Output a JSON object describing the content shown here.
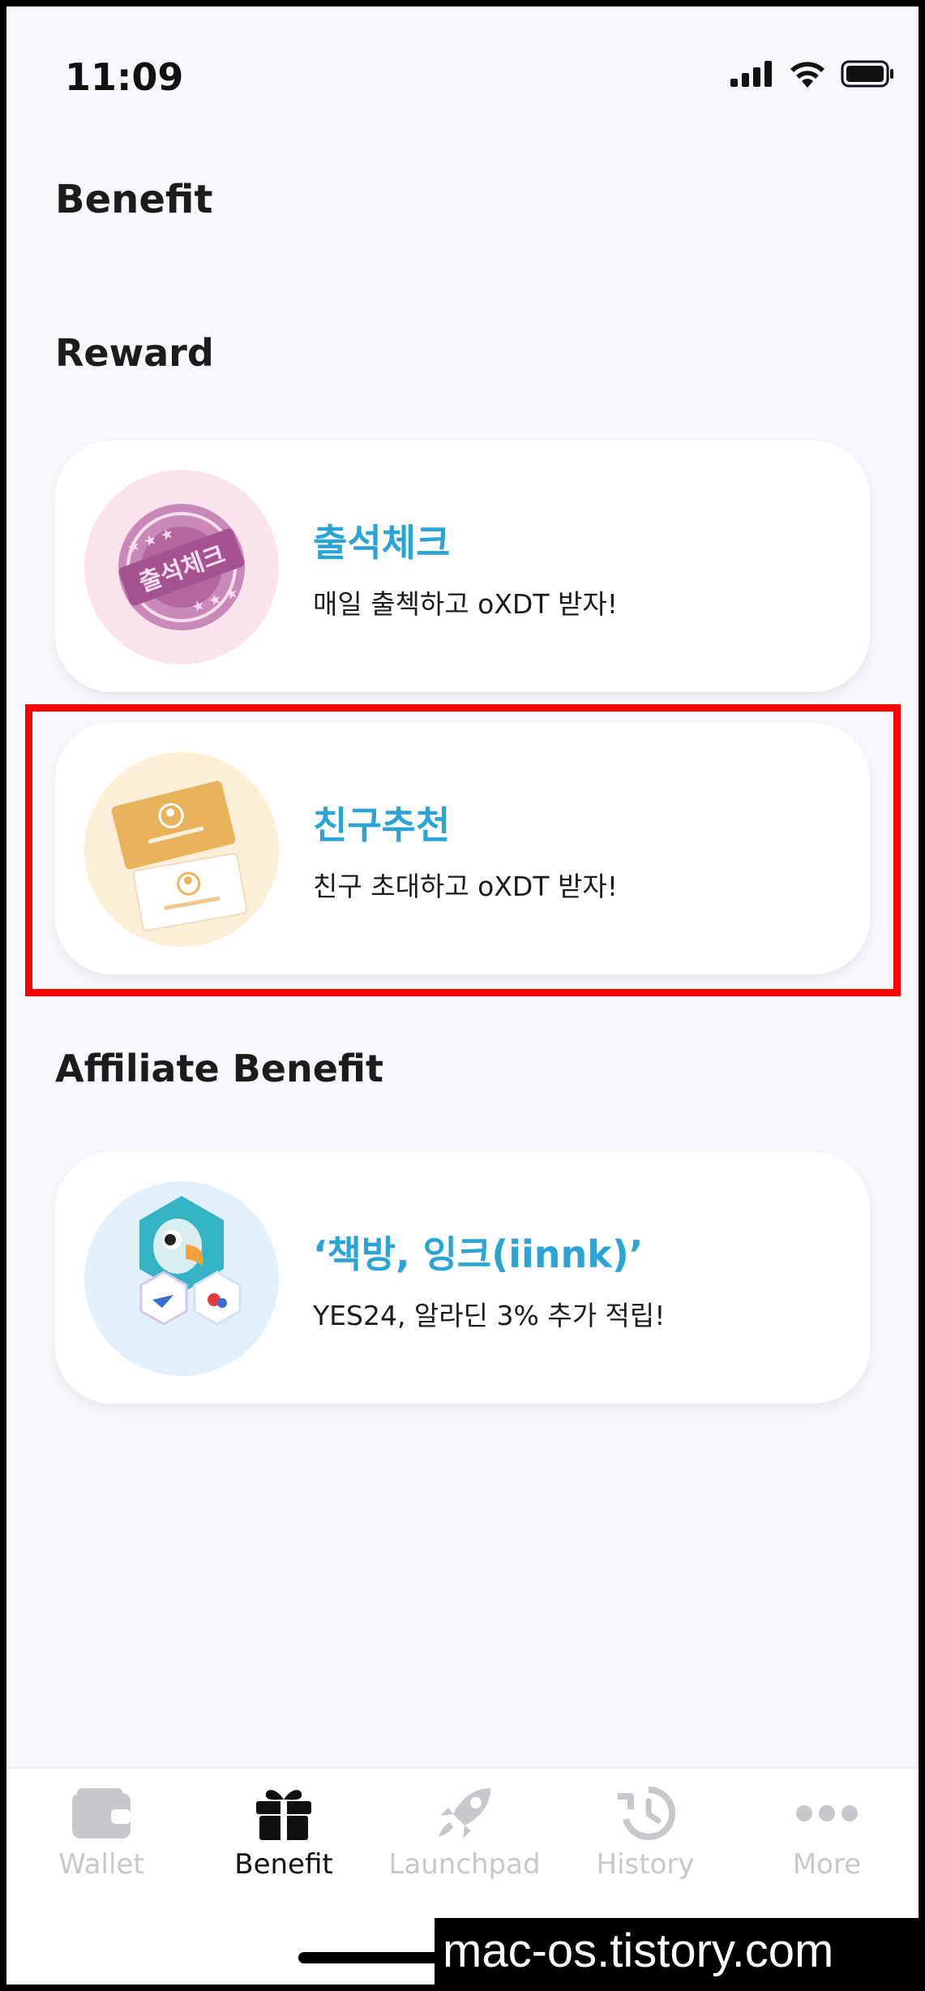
{
  "status": {
    "time": "11:09"
  },
  "page": {
    "title": "Benefit"
  },
  "sections": {
    "reward": "Reward",
    "affiliate": "Affiliate Benefit"
  },
  "cards": [
    {
      "title": "출석체크",
      "desc": "매일 출첵하고 oXDT 받자!",
      "icon": "attendance-stamp-icon",
      "stamp_text": "출석체크"
    },
    {
      "title": "친구추천",
      "desc": "친구 초대하고 oXDT 받자!",
      "icon": "referral-ticket-icon"
    },
    {
      "title": "‘책방, 잉크(iinnk)’",
      "desc": "YES24, 알라딘 3% 추가 적립!",
      "icon": "bookstore-parrot-icon"
    }
  ],
  "tabs": [
    {
      "label": "Wallet",
      "icon": "wallet-icon",
      "active": false
    },
    {
      "label": "Benefit",
      "icon": "gift-icon",
      "active": true
    },
    {
      "label": "Launchpad",
      "icon": "rocket-icon",
      "active": false
    },
    {
      "label": "History",
      "icon": "history-icon",
      "active": false
    },
    {
      "label": "More",
      "icon": "more-icon",
      "active": false
    }
  ],
  "watermark": "mac-os.tistory.com",
  "colors": {
    "accent": "#2aa3d5",
    "highlight": "#ff0000",
    "inactive_tab": "#c7c7cc"
  }
}
